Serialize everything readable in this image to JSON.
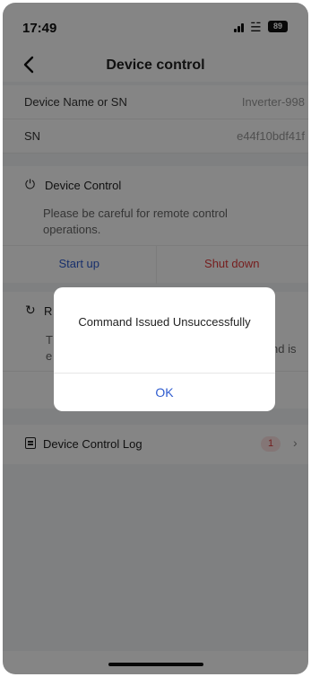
{
  "status_bar": {
    "time": "17:49",
    "battery": "89"
  },
  "nav": {
    "title": "Device control"
  },
  "info": {
    "device_name_label": "Device Name or SN",
    "device_name_value": "Inverter-998",
    "sn_label": "SN",
    "sn_value": "e44f10bdf41f"
  },
  "device_control": {
    "title": "Device Control",
    "description": "Please be careful for remote control operations.",
    "start_up_label": "Start up",
    "shut_down_label": "Shut down"
  },
  "restart_section": {
    "title_visible": "R",
    "desc_left_1": "T",
    "desc_left_2": "e",
    "desc_right": "nd is"
  },
  "log": {
    "label": "Device Control Log",
    "count": "1"
  },
  "dialog": {
    "message": "Command Issued Unsuccessfully",
    "ok_label": "OK"
  },
  "colors": {
    "accent_blue": "#2f5ccf",
    "danger_red": "#e23b3b",
    "badge_bg": "#fde3e3"
  }
}
